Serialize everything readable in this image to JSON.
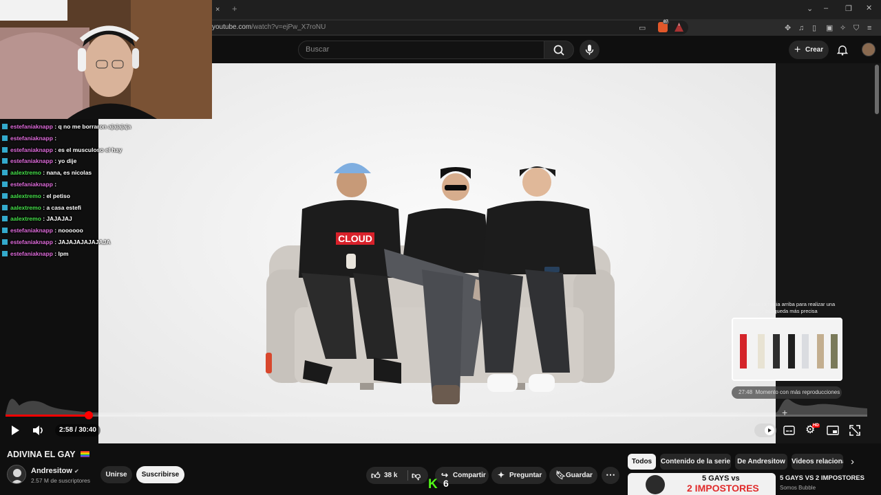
{
  "browser": {
    "url_host": "youtube.com",
    "url_path": "/watch?v=ejPw_X7roNU",
    "tab_close": "×",
    "tab_new": "+",
    "shield_badge": "87",
    "alert_badge": "1"
  },
  "header": {
    "search_placeholder": "Buscar",
    "create_label": "Crear"
  },
  "chat": {
    "messages": [
      {
        "user": "estefaniaknapp",
        "color": "pink",
        "text": ": q no me borraron ajajajaja"
      },
      {
        "user": "estefaniaknapp",
        "color": "pink",
        "text": ":"
      },
      {
        "user": "estefaniaknapp",
        "color": "pink",
        "text": ": es el musculoso el hay"
      },
      {
        "user": "estefaniaknapp",
        "color": "pink",
        "text": ": yo dije"
      },
      {
        "user": "aalextremo",
        "color": "green",
        "text": ": nana, es nicolas"
      },
      {
        "user": "estefaniaknapp",
        "color": "pink",
        "text": ":"
      },
      {
        "user": "aalextremo",
        "color": "green",
        "text": ": el petiso"
      },
      {
        "user": "aalextremo",
        "color": "green",
        "text": ": a casa estefi"
      },
      {
        "user": "aalextremo",
        "color": "green",
        "text": ": JAJAJAJ"
      },
      {
        "user": "estefaniaknapp",
        "color": "pink",
        "text": ": noooooo"
      },
      {
        "user": "estefaniaknapp",
        "color": "pink",
        "text": ": JAJAJAJAJAJAJA"
      },
      {
        "user": "estefaniaknapp",
        "color": "pink",
        "text": ": lpm"
      }
    ]
  },
  "video": {
    "hoodie_text": "CLOUD"
  },
  "player": {
    "time_current": "2:58",
    "time_sep": "/",
    "time_total": "30:40",
    "progress_fraction": 0.097,
    "hint_text": "Arrastra hacia arriba para realizar una búsqueda más precisa",
    "preview_time": "27:48",
    "preview_label": "Momento con más reproducciones",
    "hd_badge": "HD"
  },
  "below": {
    "title": "ADIVINA EL GAY",
    "channel_name": "Andresitow",
    "subscribers": "2.57 M de suscriptores",
    "join_label": "Unirse",
    "subscribe_label": "Suscribirse",
    "likes": "38 k",
    "share_label": "Compartir",
    "ask_label": "Preguntar",
    "save_label": "Guardar",
    "kick_count": "6",
    "chips": [
      "Todos",
      "Contenido de la serie",
      "De Andresitow",
      "Videos relacionados"
    ],
    "rec_thumb_line1": "5 GAYS vs",
    "rec_thumb_line2": "2 IMPOSTORES",
    "rec_title": "5 GAYS VS 2 IMPOSTORES",
    "rec_channel": "Somos Bubble"
  }
}
